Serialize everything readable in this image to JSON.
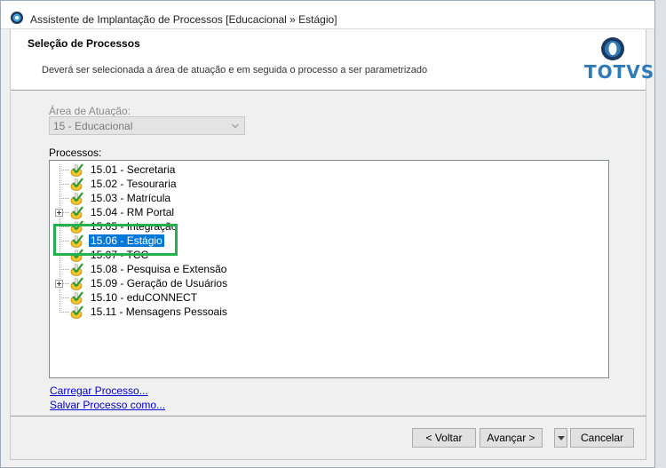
{
  "window": {
    "title": "Assistente de Implantação de Processos [Educacional » Estágio]"
  },
  "header": {
    "title": "Seleção de Processos",
    "description": "Deverá ser selecionada a área de atuação e em seguida o processo a ser parametrizado",
    "logo_text": "TOTVS"
  },
  "area": {
    "label": "Área de Atuação:",
    "value": "15 - Educacional"
  },
  "processes": {
    "label": "Processos:",
    "items": [
      {
        "label": "15.01 - Secretaria",
        "expandable": false,
        "selected": false
      },
      {
        "label": "15.02 - Tesouraria",
        "expandable": false,
        "selected": false
      },
      {
        "label": "15.03 - Matrícula",
        "expandable": false,
        "selected": false
      },
      {
        "label": "15.04 - RM Portal",
        "expandable": true,
        "selected": false
      },
      {
        "label": "15.05 - Integração",
        "expandable": false,
        "selected": false
      },
      {
        "label": "15.06 - Estágio",
        "expandable": false,
        "selected": true
      },
      {
        "label": "15.07 - TCC",
        "expandable": false,
        "selected": false
      },
      {
        "label": "15.08 - Pesquisa e Extensão",
        "expandable": false,
        "selected": false
      },
      {
        "label": "15.09 - Geração de Usuários",
        "expandable": true,
        "selected": false
      },
      {
        "label": "15.10 - eduCONNECT",
        "expandable": false,
        "selected": false
      },
      {
        "label": "15.11 - Mensagens Pessoais",
        "expandable": false,
        "selected": false
      }
    ]
  },
  "links": {
    "load": "Carregar Processo...",
    "save": "Salvar Processo como..."
  },
  "buttons": {
    "back": "< Voltar",
    "next": "Avançar >",
    "cancel": "Cancelar"
  },
  "colors": {
    "selection": "#0078d7",
    "highlight_box": "#22b14c",
    "brand": "#2f7ab8"
  },
  "icons": {
    "app": "totvs-app-icon",
    "node": "process-check-icon",
    "expand": "plus-expander-icon",
    "dropdown": "chevron-down-icon"
  }
}
